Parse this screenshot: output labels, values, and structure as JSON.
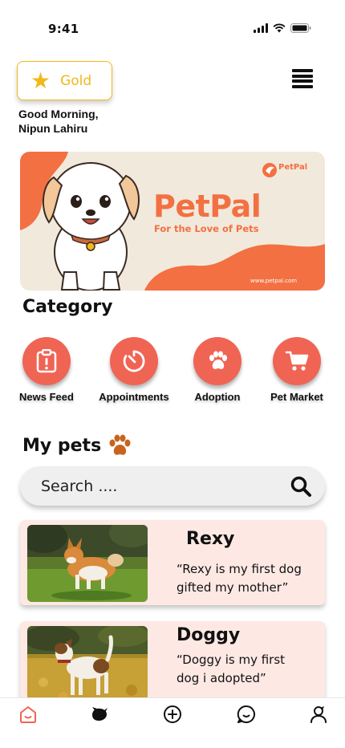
{
  "status_bar": {
    "time": "9:41"
  },
  "header": {
    "badge_label": "Gold",
    "greeting_line1": "Good Morning,",
    "greeting_line2": "Nipun Lahiru"
  },
  "banner": {
    "brand_title": "PetPal",
    "tagline": "For the Love of Pets",
    "logo_text": "PetPal",
    "url": "www.petpal.com"
  },
  "category": {
    "title": "Category",
    "items": [
      {
        "label": "News Feed",
        "icon": "clipboard-alert-icon"
      },
      {
        "label": "Appointments",
        "icon": "timer-icon"
      },
      {
        "label": "Adoption",
        "icon": "paw-icon"
      },
      {
        "label": "Pet Market",
        "icon": "cart-icon"
      }
    ]
  },
  "pets": {
    "title": "My pets",
    "search_placeholder": "Search ....",
    "items": [
      {
        "name": "Rexy",
        "quote_line1": "“Rexy is my  first  dog",
        "quote_line2": "gifted  my  mother”"
      },
      {
        "name": "Doggy",
        "quote_line1": "“Doggy is my   first",
        "quote_line2": "dog i adopted”"
      }
    ]
  },
  "bottom_nav": {
    "items": [
      "home-icon",
      "pet-icon",
      "add-icon",
      "chat-icon",
      "profile-icon"
    ]
  },
  "colors": {
    "accent": "#f06454",
    "brand_orange": "#f37042",
    "gold": "#f2b81a",
    "card_bg": "#fde8e4"
  }
}
